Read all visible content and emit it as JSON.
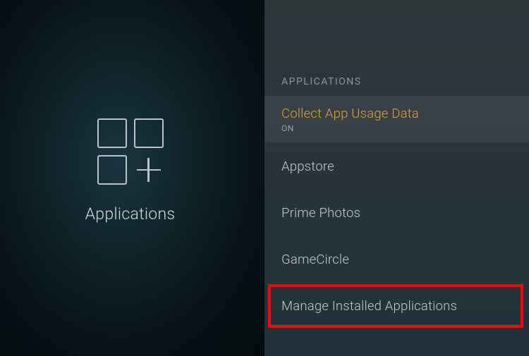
{
  "left": {
    "title": "Applications"
  },
  "right": {
    "section_label": "APPLICATIONS",
    "items": [
      {
        "title": "Collect App Usage Data",
        "sub": "ON"
      },
      {
        "title": "Appstore"
      },
      {
        "title": "Prime Photos"
      },
      {
        "title": "GameCircle"
      },
      {
        "title": "Manage Installed Applications"
      }
    ]
  }
}
